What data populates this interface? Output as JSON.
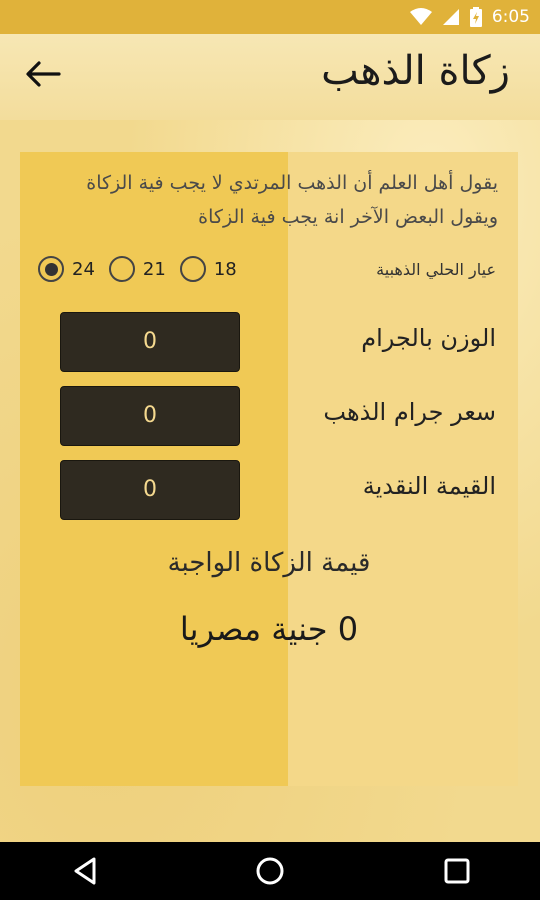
{
  "status_bar": {
    "time": "6:05",
    "icons": [
      "wifi-icon",
      "signal-icon",
      "battery-charging-icon"
    ]
  },
  "app_bar": {
    "title": "زكاة الذهب",
    "back_icon": "arrow-left-icon"
  },
  "intro": {
    "text": "يقول أهل العلم أن الذهب المرتدي لا يجب فية الزكاة ويقول البعض الآخر انة يجب فية الزكاة"
  },
  "karat": {
    "label": "عيار الحلي الذهبية",
    "options": [
      {
        "label": "24",
        "selected": true
      },
      {
        "label": "21",
        "selected": false
      },
      {
        "label": "18",
        "selected": false
      }
    ]
  },
  "fields": [
    {
      "label": "الوزن بالجرام",
      "value": "0"
    },
    {
      "label": "سعر جرام الذهب",
      "value": "0"
    },
    {
      "label": "القيمة النقدية",
      "value": "0"
    }
  ],
  "result": {
    "label": "قيمة الزكاة الواجبة",
    "value": "0 جنية مصريا"
  },
  "nav_bar": {
    "buttons": [
      "back-triangle-icon",
      "home-circle-icon",
      "recents-square-icon"
    ]
  },
  "colors": {
    "status_bar": "#e0b23a",
    "card": "#f0c955",
    "input_bg": "#2f2a20",
    "input_text": "#f5d98f"
  }
}
